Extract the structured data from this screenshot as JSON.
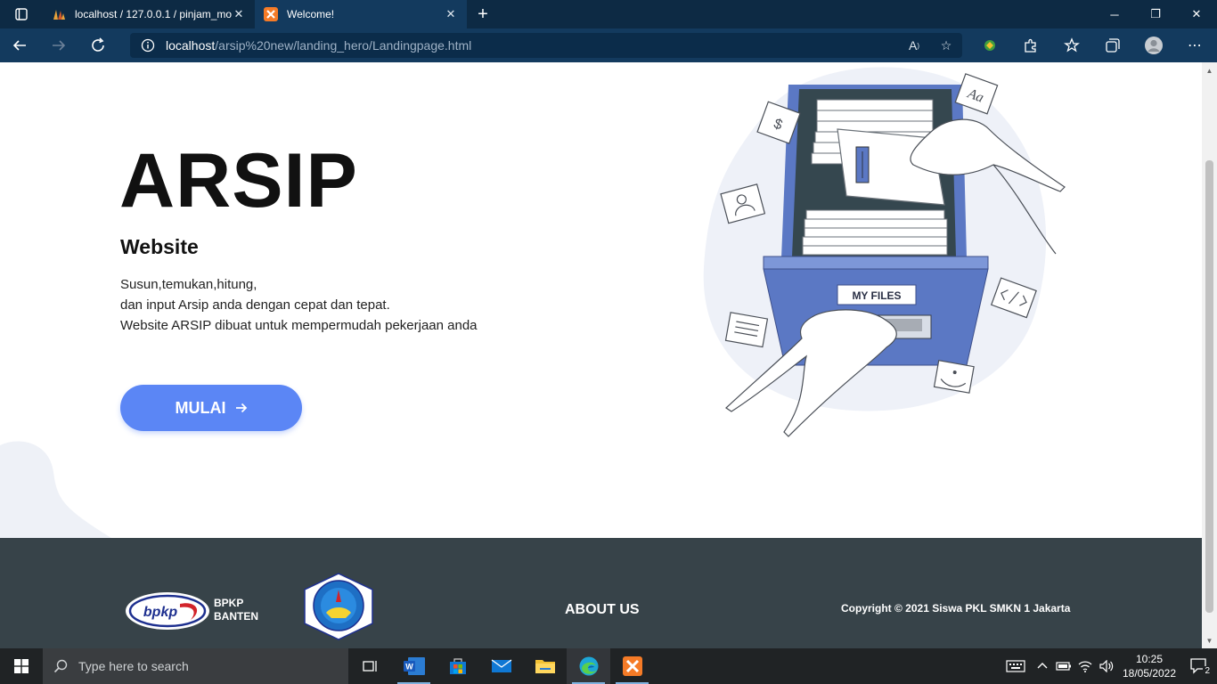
{
  "browser": {
    "tabs": [
      {
        "title": "localhost / 127.0.0.1 / pinjam_mo",
        "active": false
      },
      {
        "title": "Welcome!",
        "active": true
      }
    ],
    "url_host": "localhost",
    "url_path": "/arsip%20new/landing_hero/Landingpage.html"
  },
  "hero": {
    "title": "ARSIP",
    "subtitle": "Website",
    "description_lines": [
      "Susun,temukan,hitung,",
      "dan input Arsip anda dengan cepat dan tepat.",
      "Website ARSIP dibuat untuk mempermudah pekerjaan anda"
    ],
    "start_button": "MULAI"
  },
  "illustration": {
    "drawer_label": "MY FILES",
    "card_letters": "Aa",
    "dollar_sign": "$"
  },
  "footer": {
    "bpkp_logo_text": "bpkp",
    "bpkp_name_line1": "BPKP",
    "bpkp_name_line2": "BANTEN",
    "about_us": "ABOUT US",
    "copyright": "Copyright © 2021 Siswa PKL SMKN 1 Jakarta"
  },
  "taskbar": {
    "search_placeholder": "Type here to search",
    "time": "10:25",
    "date": "18/05/2022",
    "notification_count": "2"
  },
  "colors": {
    "accent": "#5b86f5",
    "footer_bg": "#374349",
    "browser_bg": "#0d2a44"
  }
}
